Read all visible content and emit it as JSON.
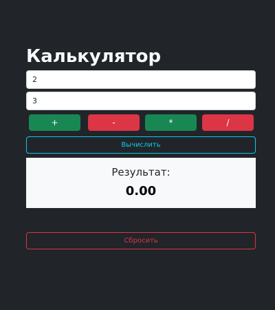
{
  "title": "Калькулятор",
  "inputs": {
    "first": "2",
    "second": "3"
  },
  "operations": [
    {
      "label": "+",
      "color": "#198754"
    },
    {
      "label": "-",
      "color": "#dc3545"
    },
    {
      "label": "*",
      "color": "#198754"
    },
    {
      "label": "/",
      "color": "#dc3545"
    }
  ],
  "calculate_label": "Вычислить",
  "result": {
    "label": "Результат:",
    "value": "0.00"
  },
  "reset_label": "Сбросить",
  "colors": {
    "background": "#212529",
    "accent_info": "#0dcaf0",
    "accent_danger": "#dc3545",
    "accent_success": "#198754"
  }
}
